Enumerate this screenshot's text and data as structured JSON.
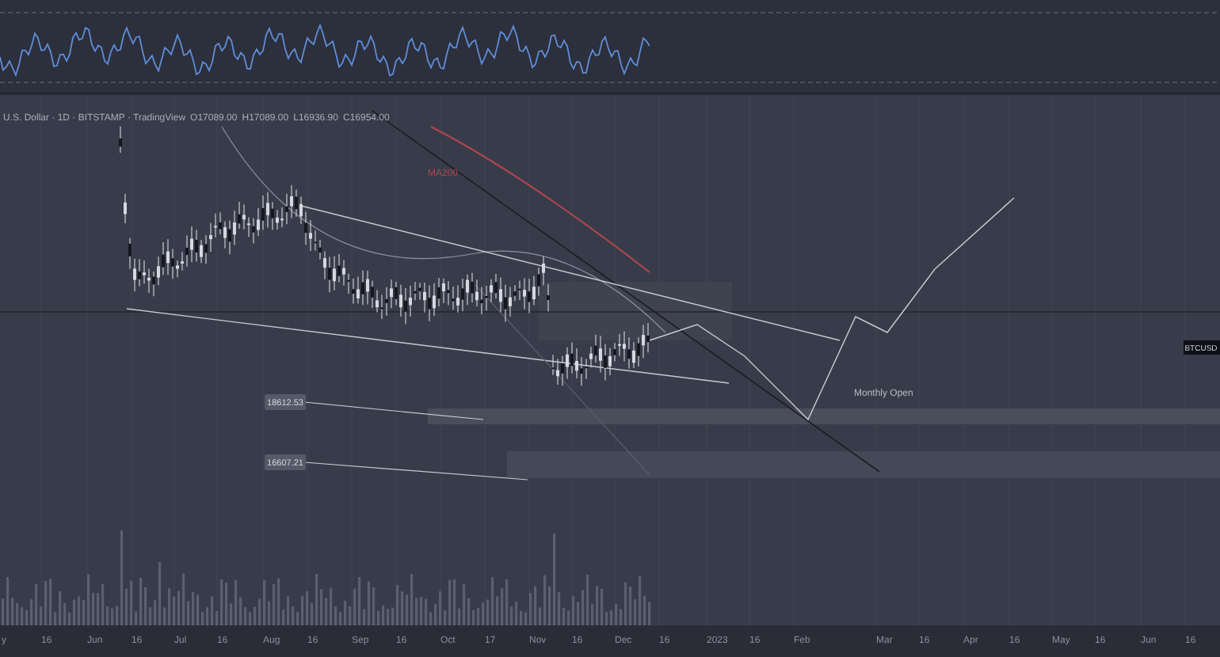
{
  "header": {
    "symbol": "U.S. Dollar · 1D · BITSTAMP · TradingView",
    "ohlc": [
      {
        "key": "O",
        "value": "17089.00"
      },
      {
        "key": "H",
        "value": "17089.00"
      },
      {
        "key": "L",
        "value": "16936.90"
      },
      {
        "key": "C",
        "value": "16954.00"
      }
    ]
  },
  "annotations": {
    "ma_label": "MA200",
    "price_labels": [
      "18612.53",
      "16607.21"
    ],
    "monthly_open": "Monthly Open",
    "symbol_tag": "BTCUSD"
  },
  "x_axis": {
    "labels": [
      "y",
      "16",
      "Jun",
      "16",
      "Jul",
      "16",
      "Aug",
      "16",
      "Sep",
      "16",
      "Oct",
      "17",
      "Nov",
      "16",
      "Dec",
      "16",
      "2023",
      "16",
      "Feb",
      "Mar",
      "16",
      "Apr",
      "16",
      "May",
      "16",
      "Jun",
      "16"
    ]
  }
}
